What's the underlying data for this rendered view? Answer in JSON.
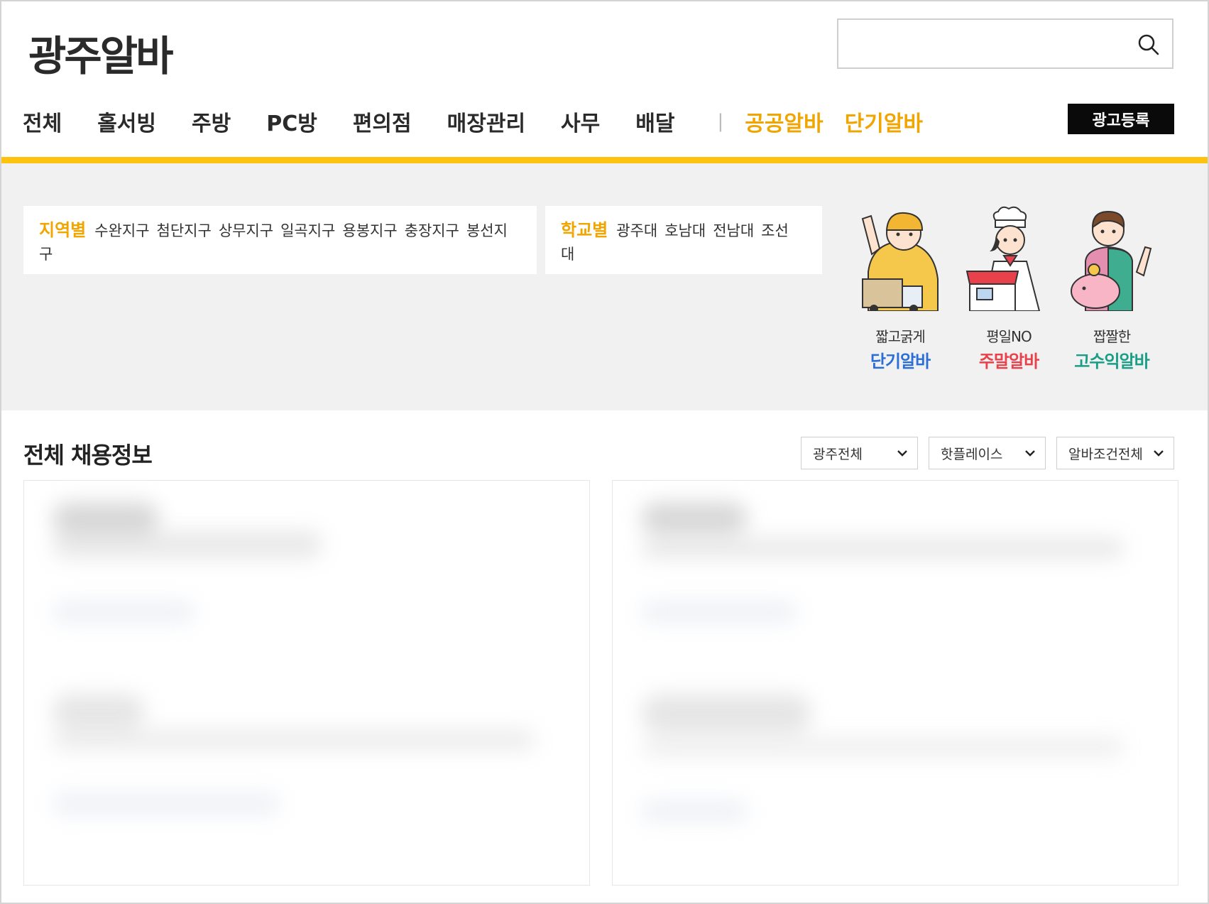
{
  "header": {
    "logo": "광주알바",
    "search_placeholder": ""
  },
  "nav": {
    "items": [
      "전체",
      "홀서빙",
      "주방",
      "PC방",
      "편의점",
      "매장관리",
      "사무",
      "배달"
    ],
    "separator": "|",
    "highlight_items": [
      "공공알바",
      "단기알바"
    ],
    "ad_button": "광고등록"
  },
  "filters": {
    "region": {
      "heading": "지역별",
      "links": [
        "수완지구",
        "첨단지구",
        "상무지구",
        "일곡지구",
        "용봉지구",
        "충장지구",
        "봉선지구"
      ]
    },
    "school": {
      "heading": "학교별",
      "links": [
        "광주대",
        "호남대",
        "전남대",
        "조선대"
      ]
    }
  },
  "promos": [
    {
      "line1": "짧고굵게",
      "line2": "단기알바",
      "color": "#2b6fd6",
      "icon": "delivery-worker-icon"
    },
    {
      "line1": "평일NO",
      "line2": "주말알바",
      "color": "#e8414b",
      "icon": "chef-store-icon"
    },
    {
      "line1": "짭짤한",
      "line2": "고수익알바",
      "color": "#1a9e85",
      "icon": "piggy-bank-worker-icon"
    }
  ],
  "listing": {
    "title": "전체 채용정보",
    "selects": [
      "광주전체",
      "핫플레이스",
      "알바조건전체"
    ]
  },
  "colors": {
    "accent": "#ffc20e",
    "highlight_text": "#f0a500",
    "filter_bg": "#f1f1f1"
  }
}
